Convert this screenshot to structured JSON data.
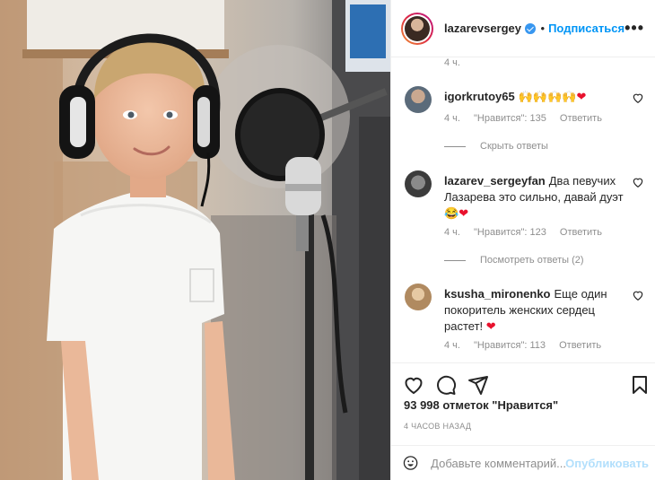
{
  "post": {
    "username": "lazarevsergey",
    "dot": "•",
    "follow_label": "Подписаться",
    "more_label": "•••",
    "time_top": "4 ч."
  },
  "comments": [
    {
      "username": "igorkrutoy65",
      "text": "🙌🙌🙌🙌",
      "text_heart": "❤",
      "time": "4 ч.",
      "likes": "\"Нравится\": 135",
      "reply": "Ответить"
    },
    {
      "username": "lazarev_sergeyfan",
      "text": "Два певучих Лазарева это сильно, давай дуэт",
      "text_emoji": "😂",
      "text_heart": "❤",
      "time": "4 ч.",
      "likes": "\"Нравится\": 123",
      "reply": "Ответить"
    },
    {
      "username": "ksusha_mironenko",
      "text": "Еще один покоритель женских сердец растет!",
      "text_heart": "❤",
      "time": "4 ч.",
      "likes": "\"Нравится\": 113",
      "reply": "Ответить"
    }
  ],
  "replies": {
    "hide_label": "Скрыть ответы",
    "show_label": "Посмотреть ответы (2)"
  },
  "stats": {
    "likes_text": "93 998 отметок \"Нравится\"",
    "posted": "4 часов назад"
  },
  "add_comment": {
    "placeholder": "Добавьте комментарий...",
    "publish_label": "Опубликовать"
  },
  "colors": {
    "accent": "#0095f6",
    "verified": "#3897f0",
    "muted": "#8e8e8e",
    "heart": "#e8112d"
  }
}
